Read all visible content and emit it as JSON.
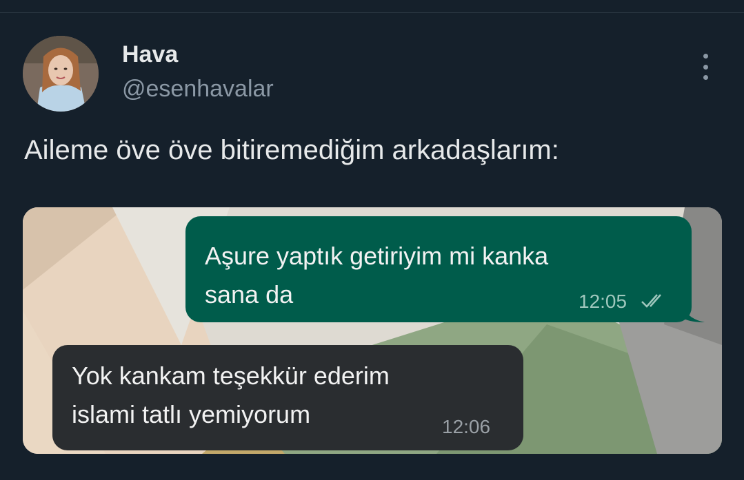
{
  "author": {
    "display_name": "Hava",
    "handle": "@esenhavalar"
  },
  "tweet": {
    "text": "Aileme öve öve bitiremediğim arkadaşlarım:"
  },
  "chat": {
    "messages": [
      {
        "direction": "outgoing",
        "lines": [
          "Aşure yaptık getiriyim mi kanka",
          "sana da"
        ],
        "time": "12:05",
        "status_icon": "double-check-icon"
      },
      {
        "direction": "incoming",
        "lines": [
          "Yok kankam teşekkür ederim",
          "islami tatlı yemiyorum"
        ],
        "time": "12:06"
      }
    ]
  },
  "colors": {
    "background": "#15202b",
    "outgoing_bubble": "#005c4b",
    "incoming_bubble": "#2a2d30",
    "secondary_text": "#8b98a5"
  },
  "icons": [
    "more-options-icon",
    "double-check-icon"
  ]
}
